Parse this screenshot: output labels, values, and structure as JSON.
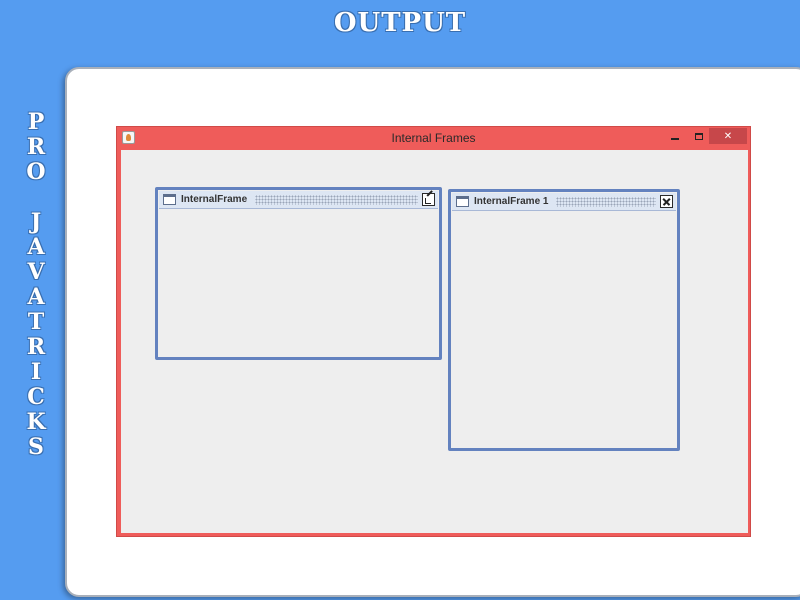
{
  "heading": "OUTPUT",
  "side_brand": [
    "P",
    "R",
    "O",
    "",
    "J",
    "A",
    "V",
    "A",
    "T",
    "R",
    "I",
    "C",
    "K",
    "S"
  ],
  "app_window": {
    "title": "Internal Frames",
    "close_glyph": "✕"
  },
  "internal_frames": [
    {
      "title": "InternalFrame",
      "button": "iconify-icon"
    },
    {
      "title": "InternalFrame 1",
      "button": "close-icon"
    }
  ],
  "colors": {
    "background": "#559cf0",
    "app_border": "#ef5c5a",
    "frame_border": "#6382bf",
    "desktop": "#eeeeee"
  }
}
